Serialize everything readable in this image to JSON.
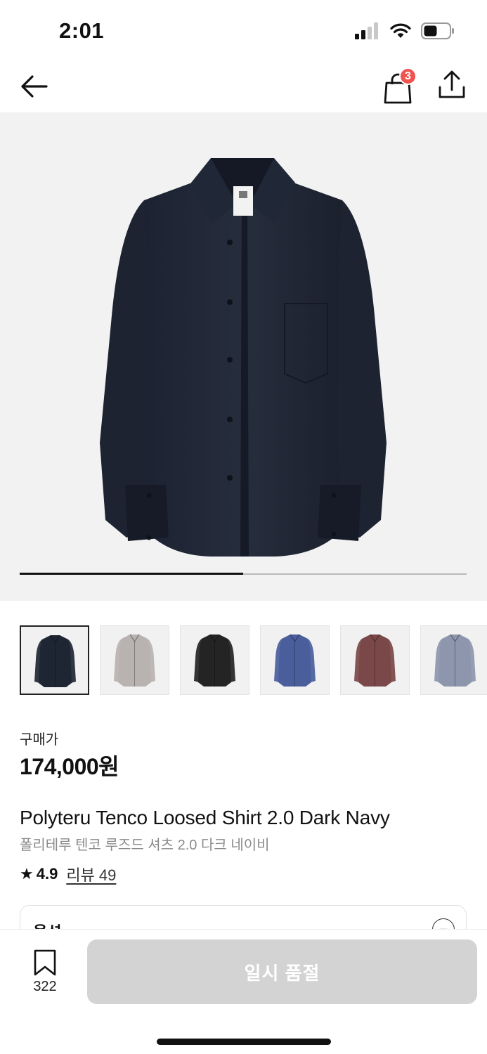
{
  "status_bar": {
    "time": "2:01",
    "icons": [
      "signal-icon",
      "wifi-icon",
      "battery-icon"
    ]
  },
  "top_nav": {
    "back_icon": "arrow-left-icon",
    "cart_icon": "shopping-bag-icon",
    "cart_badge": "3",
    "share_icon": "share-icon"
  },
  "hero": {
    "image": "dark navy long sleeve shirt",
    "carousel_progress": 0.5
  },
  "thumbnails": [
    {
      "color": "#1f2633",
      "label": "dark navy"
    },
    {
      "color": "#b8b2b0",
      "label": "light gray"
    },
    {
      "color": "#242424",
      "label": "black"
    },
    {
      "color": "#4a5e9c",
      "label": "blue"
    },
    {
      "color": "#7a4848",
      "label": "brown"
    },
    {
      "color": "#8d96ad",
      "label": "light blue gray"
    }
  ],
  "price": {
    "label": "구매가",
    "value": "174,000원"
  },
  "product": {
    "name_en": "Polyteru Tenco Loosed Shirt 2.0 Dark Navy",
    "name_ko": "폴리테루 텐코 루즈드 셔츠 2.0 다크 네이비"
  },
  "rating": {
    "score": "4.9",
    "review_label": "리뷰 49"
  },
  "option": {
    "title": "옵션",
    "toggle": "−"
  },
  "bottom_bar": {
    "bookmark_count": "322",
    "soldout_label": "일시 품절"
  },
  "colors": {
    "badge": "#ef5350",
    "disabled_button": "#d3d3d3"
  }
}
